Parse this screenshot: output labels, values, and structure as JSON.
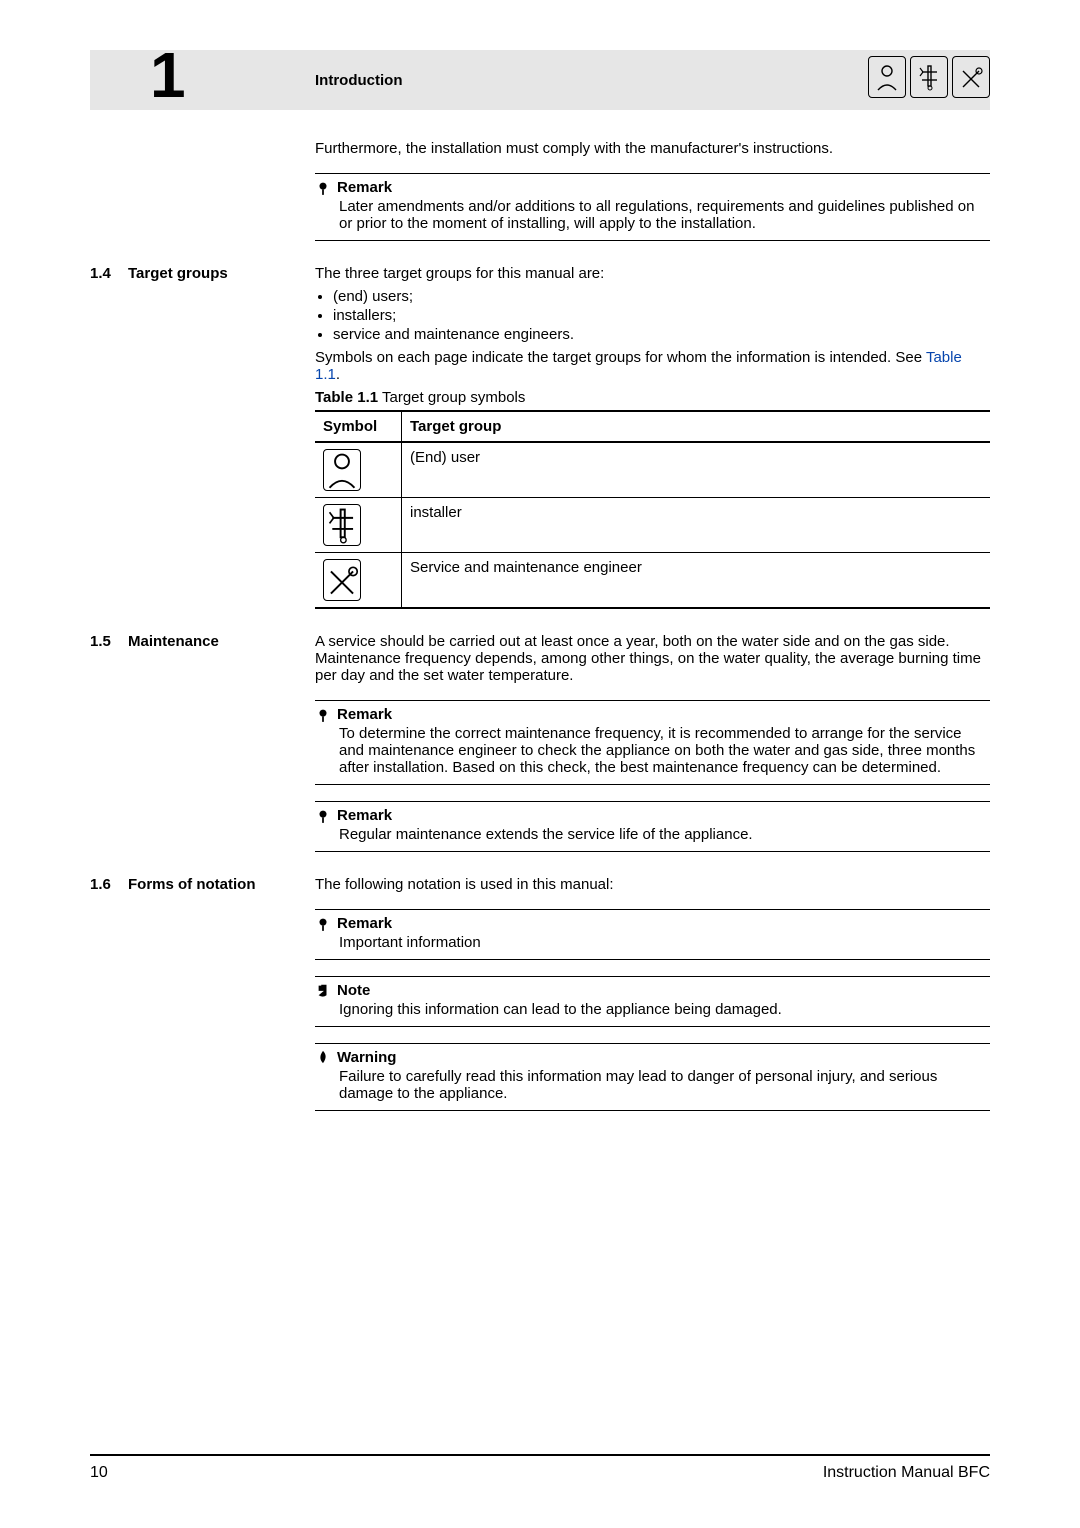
{
  "chapter": {
    "number": "1",
    "title": "Introduction"
  },
  "p_furthermore": "Furthermore, the installation must comply with the manufacturer's instructions.",
  "r_amend": {
    "title": "Remark",
    "body": "Later amendments and/or additions to all regulations, requirements and guidelines published on or prior to the moment of installing, will apply to the installation."
  },
  "s14": {
    "num": "1.4",
    "title": "Target groups",
    "intro": "The three target groups for this manual are:",
    "bullets": [
      "(end) users;",
      "installers;",
      "service and maintenance engineers."
    ],
    "p_symbols": "Symbols on each page indicate the target groups for whom the information is intended. See ",
    "link": "Table 1.1",
    "table_caption_bold": "Table 1.1",
    "table_caption_rest": " Target group symbols",
    "table": {
      "h1": "Symbol",
      "h2": "Target group",
      "rows": [
        {
          "group": "(End) user",
          "icon": "user"
        },
        {
          "group": "installer",
          "icon": "installer"
        },
        {
          "group": "Service and maintenance engineer",
          "icon": "wrench"
        }
      ]
    }
  },
  "s15": {
    "num": "1.5",
    "title": "Maintenance",
    "p": "A service should be carried out at least once a year, both on the water side and on the gas side. Maintenance frequency depends, among other things, on the water quality, the average burning time per day and the set water temperature.",
    "r1": {
      "title": "Remark",
      "body": "To determine the correct maintenance frequency, it is recommended to arrange for the service and maintenance engineer to check the appliance on both the water and gas side, three months after installation. Based on this check, the best maintenance frequency can be determined."
    },
    "r2": {
      "title": "Remark",
      "body": "Regular maintenance extends the service life of the appliance."
    }
  },
  "s16": {
    "num": "1.6",
    "title": "Forms of notation",
    "intro": "The following notation is used in this manual:",
    "remark": {
      "title": "Remark",
      "body": "Important information"
    },
    "note": {
      "title": "Note",
      "body": "Ignoring this information can lead to the appliance being damaged."
    },
    "warning": {
      "title": "Warning",
      "body": "Failure to carefully read this information may lead to danger of personal injury, and serious damage to the appliance."
    }
  },
  "footer": {
    "page": "10",
    "doc": "Instruction Manual BFC"
  }
}
